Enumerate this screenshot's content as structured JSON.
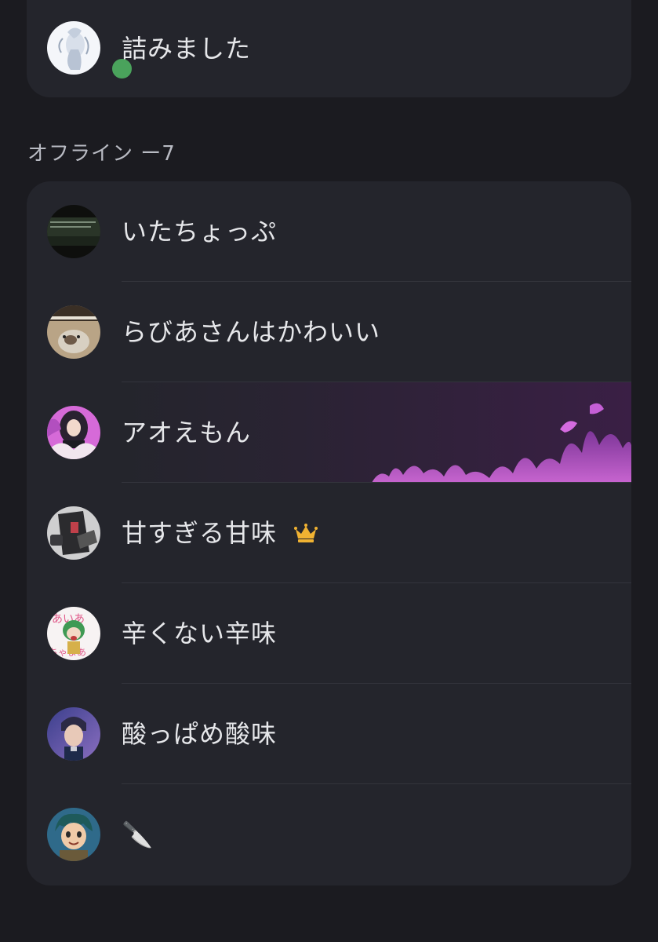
{
  "online": {
    "members": [
      {
        "name": "詰みました",
        "status": "online"
      }
    ]
  },
  "offline": {
    "header": "オフライン ー7",
    "members": [
      {
        "name": "いたちょっぷ"
      },
      {
        "name": "らびあさんはかわいい"
      },
      {
        "name": "アオえもん",
        "banner": "purple-flames"
      },
      {
        "name": "甘すぎる甘味",
        "badge": "crown-icon"
      },
      {
        "name": "辛くない辛味"
      },
      {
        "name": "酸っぱめ酸味"
      },
      {
        "name": "🔪"
      }
    ]
  },
  "colors": {
    "background": "#1b1b20",
    "card": "#24252c",
    "online_dot": "#4aa35c",
    "crown": "#f0b232"
  }
}
